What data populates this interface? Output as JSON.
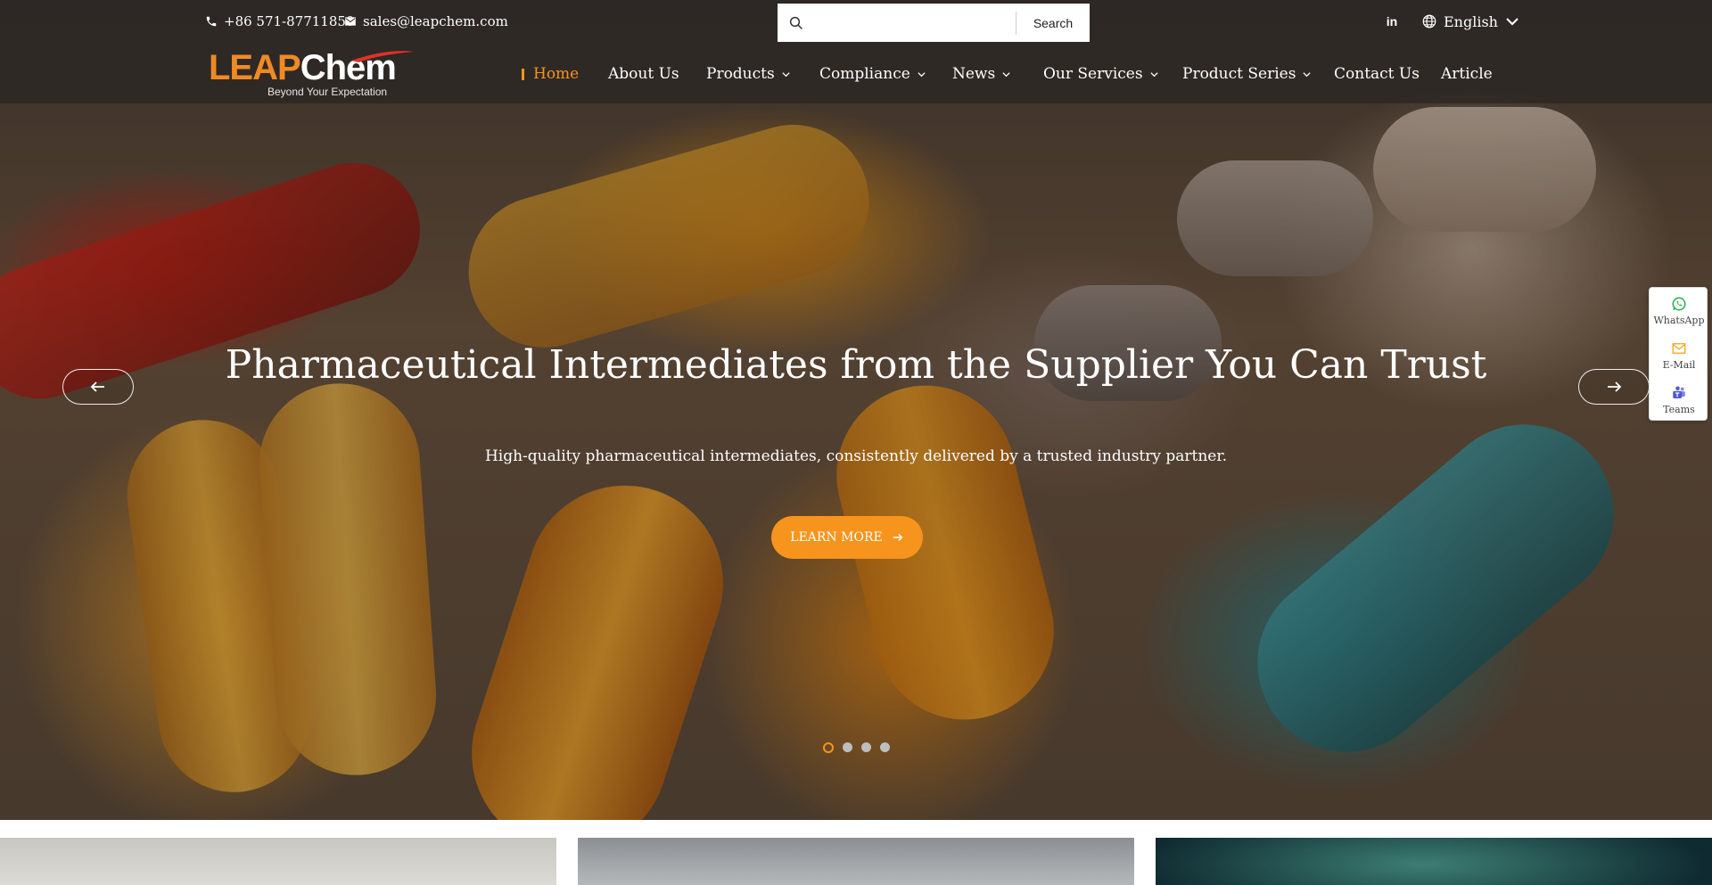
{
  "topbar": {
    "phone": "+86 571-87711850",
    "email": "sales@leapchem.com",
    "search": {
      "placeholder": "",
      "button_label": "Search",
      "icon": "search-icon"
    },
    "social": {
      "linkedin_label": "in",
      "icon": "linkedin-icon"
    },
    "language": {
      "selected": "English",
      "icon": "globe-icon"
    }
  },
  "logo": {
    "leap": "LEAP",
    "chem": "Chem",
    "tagline": "Beyond Your Expectation"
  },
  "nav": {
    "items": [
      {
        "label": "Home",
        "active": true,
        "dropdown": false
      },
      {
        "label": "About Us",
        "dropdown": false
      },
      {
        "label": "Products",
        "dropdown": true
      },
      {
        "label": "Compliance",
        "dropdown": true
      },
      {
        "label": "News",
        "dropdown": true
      },
      {
        "label": "Our Services",
        "dropdown": true
      },
      {
        "label": "Product Series",
        "dropdown": true
      },
      {
        "label": "Contact Us",
        "dropdown": false
      },
      {
        "label": "Article",
        "dropdown": false
      }
    ]
  },
  "hero": {
    "title": "Pharmaceutical Intermediates from the Supplier You Can Trust",
    "subtitle": "High-quality pharmaceutical intermediates, consistently delivered by a trusted industry partner.",
    "cta_label": "LEARN MORE",
    "slide_count": 4,
    "active_slide": 1
  },
  "side_widget": {
    "items": [
      {
        "label": "WhatsApp",
        "icon": "whatsapp-icon",
        "color": "#25b14a"
      },
      {
        "label": "E-Mail",
        "icon": "mail-icon",
        "color": "#f5a623"
      },
      {
        "label": "Teams",
        "icon": "teams-icon",
        "color": "#5059c9"
      }
    ]
  },
  "colors": {
    "accent": "#f7941d",
    "topbar": "#282624"
  }
}
